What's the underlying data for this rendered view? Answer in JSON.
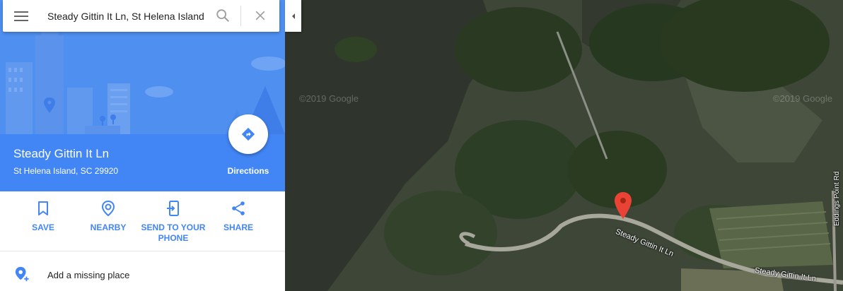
{
  "search": {
    "value": "Steady Gittin It Ln, St Helena Island"
  },
  "place": {
    "title": "Steady Gittin It Ln",
    "address": "St Helena Island, SC 29920"
  },
  "directions": {
    "label": "Directions"
  },
  "actions": [
    {
      "label": "SAVE",
      "icon": "bookmark-icon"
    },
    {
      "label": "NEARBY",
      "icon": "nearby-icon"
    },
    {
      "label": "SEND TO YOUR PHONE",
      "icon": "send-to-phone-icon"
    },
    {
      "label": "SHARE",
      "icon": "share-icon"
    }
  ],
  "add_missing_place": {
    "label": "Add a missing place",
    "icon": "add-location-icon"
  },
  "map": {
    "road_labels": [
      "Steady Gittin It Ln",
      "Steady Gittin It Ln",
      "Eddings Point Rd"
    ],
    "watermark": "©2019 Google",
    "pin_color": "#ea4335"
  },
  "colors": {
    "accent": "#4285f4"
  }
}
